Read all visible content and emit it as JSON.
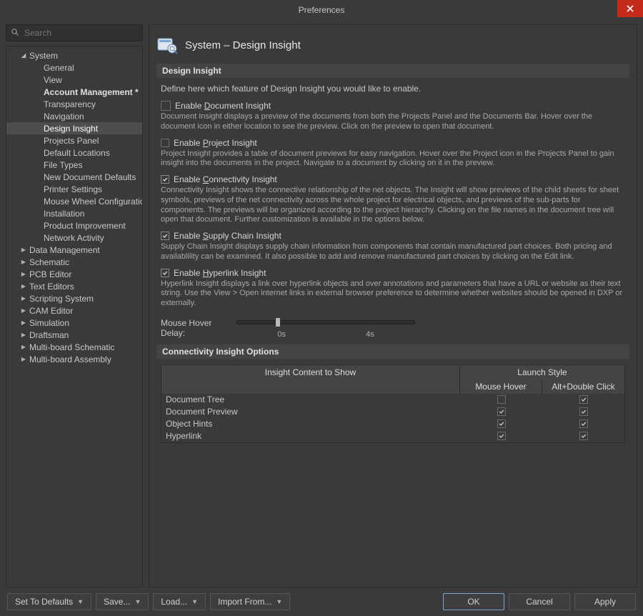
{
  "window": {
    "title": "Preferences"
  },
  "search": {
    "placeholder": "Search"
  },
  "tree": {
    "top": [
      {
        "label": "System",
        "expanded": true,
        "children": [
          "General",
          "View",
          "Account Management *",
          "Transparency",
          "Navigation",
          "Design Insight",
          "Projects Panel",
          "Default Locations",
          "File Types",
          "New Document Defaults",
          "Printer Settings",
          "Mouse Wheel Configuration",
          "Installation",
          "Product Improvement",
          "Network Activity"
        ],
        "bold_child_index": 2,
        "selected_child_index": 5
      },
      {
        "label": "Data Management",
        "expanded": false
      },
      {
        "label": "Schematic",
        "expanded": false
      },
      {
        "label": "PCB Editor",
        "expanded": false
      },
      {
        "label": "Text Editors",
        "expanded": false
      },
      {
        "label": "Scripting System",
        "expanded": false
      },
      {
        "label": "CAM Editor",
        "expanded": false
      },
      {
        "label": "Simulation",
        "expanded": false
      },
      {
        "label": "Draftsman",
        "expanded": false
      },
      {
        "label": "Multi-board Schematic",
        "expanded": false
      },
      {
        "label": "Multi-board Assembly",
        "expanded": false
      }
    ]
  },
  "page": {
    "heading": "System – Design Insight",
    "section1_title": "Design Insight",
    "intro": "Define here which feature of Design Insight you would like to enable.",
    "opts": [
      {
        "key": "doc",
        "label_pre": "Enable ",
        "mnemonic": "D",
        "label_post": "ocument Insight",
        "checked": false,
        "desc": "Document Insight displays a preview of the documents from both the Projects Panel and the Documents Bar. Hover over the document icon in either location to see the preview. Click on the preview to open that document."
      },
      {
        "key": "proj",
        "label_pre": "Enable ",
        "mnemonic": "P",
        "label_post": "roject Insight",
        "checked": false,
        "desc": "Project Insight provides a table of document previews for easy navigation. Hover over the Project icon in the Projects Panel to gain insight into the documents in the project. Navigate to a document by clicking on it in the preview."
      },
      {
        "key": "conn",
        "label_pre": "Enable ",
        "mnemonic": "C",
        "label_post": "onnectivity Insight",
        "checked": true,
        "desc": "Connectivity Insight shows the connective relationship of the net objects. The Insight will show previews of the child sheets for sheet symbols, previews of the net connectivity across the whole project for electrical objects, and previews of the sub-parts for components. The previews will be organized according to the project hierarchy. Clicking on the file names in the document tree will open that document. Further customization is available in the options below."
      },
      {
        "key": "supply",
        "label_pre": "Enable ",
        "mnemonic": "S",
        "label_post": "upply Chain Insight",
        "checked": true,
        "desc": "Supply Chain Insight displays supply chain information from components that contain manufactured part choices. Both pricing and availablility can be examined. It also possible to add and remove manufactured part choices by clicking on the Edit link."
      },
      {
        "key": "hyper",
        "label_pre": "Enable ",
        "mnemonic": "H",
        "label_post": "yperlink Insight",
        "checked": true,
        "desc": "Hyperlink Insight displays a link over hyperlink objects and over annotations and parameters that have a URL or website as their text string. Use the View > Open internet links in external browser preference to determine whether websites should be opened in DXP or externally."
      }
    ],
    "slider_label": "Mouse Hover Delay:",
    "slider_min": "0s",
    "slider_max": "4s",
    "section2_title": "Connectivity Insight Options",
    "table": {
      "head_content": "Insight Content to Show",
      "head_launch": "Launch Style",
      "col_hover": "Mouse Hover",
      "col_alt": "Alt+Double Click",
      "rows": [
        {
          "label": "Document Tree",
          "hover": false,
          "alt": true
        },
        {
          "label": "Document Preview",
          "hover": true,
          "alt": true
        },
        {
          "label": "Object Hints",
          "hover": true,
          "alt": true
        },
        {
          "label": "Hyperlink",
          "hover": true,
          "alt": true
        }
      ]
    }
  },
  "footer": {
    "set_defaults": "Set To Defaults",
    "save": "Save...",
    "load": "Load...",
    "import": "Import From...",
    "ok": "OK",
    "cancel": "Cancel",
    "apply": "Apply"
  }
}
